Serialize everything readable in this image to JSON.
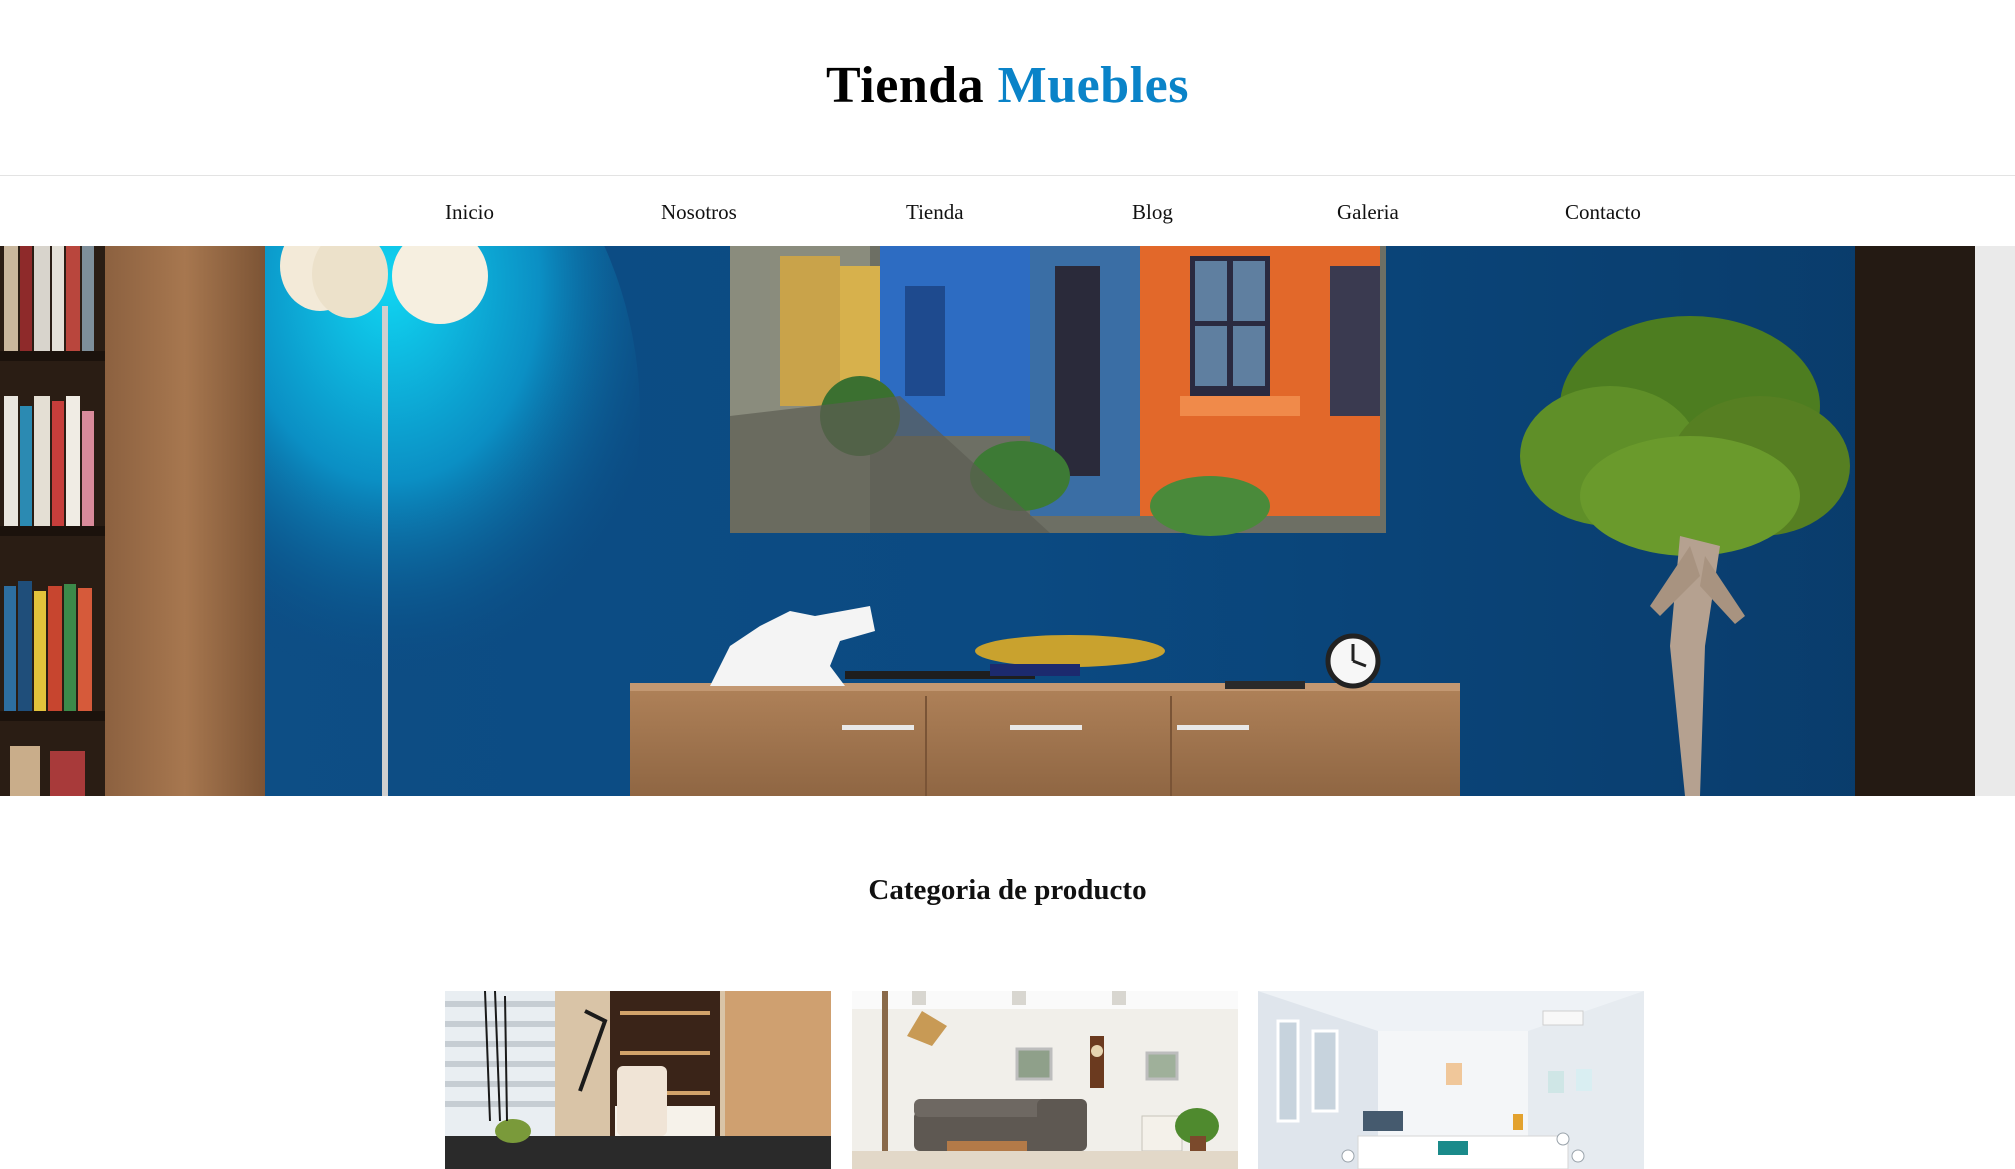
{
  "brand": {
    "part1": "Tienda",
    "part2": "Muebles",
    "accent_color": "#0a83c8"
  },
  "nav": {
    "items": [
      {
        "label": "Inicio"
      },
      {
        "label": "Nosotros"
      },
      {
        "label": "Tienda"
      },
      {
        "label": "Blog"
      },
      {
        "label": "Galeria"
      },
      {
        "label": "Contacto"
      }
    ]
  },
  "hero": {
    "image": "hero-living-room-photo"
  },
  "categories": {
    "title": "Categoria de producto",
    "cards": [
      {
        "image": "office-room-photo"
      },
      {
        "image": "living-room-photo"
      },
      {
        "image": "meeting-room-photo"
      }
    ]
  }
}
